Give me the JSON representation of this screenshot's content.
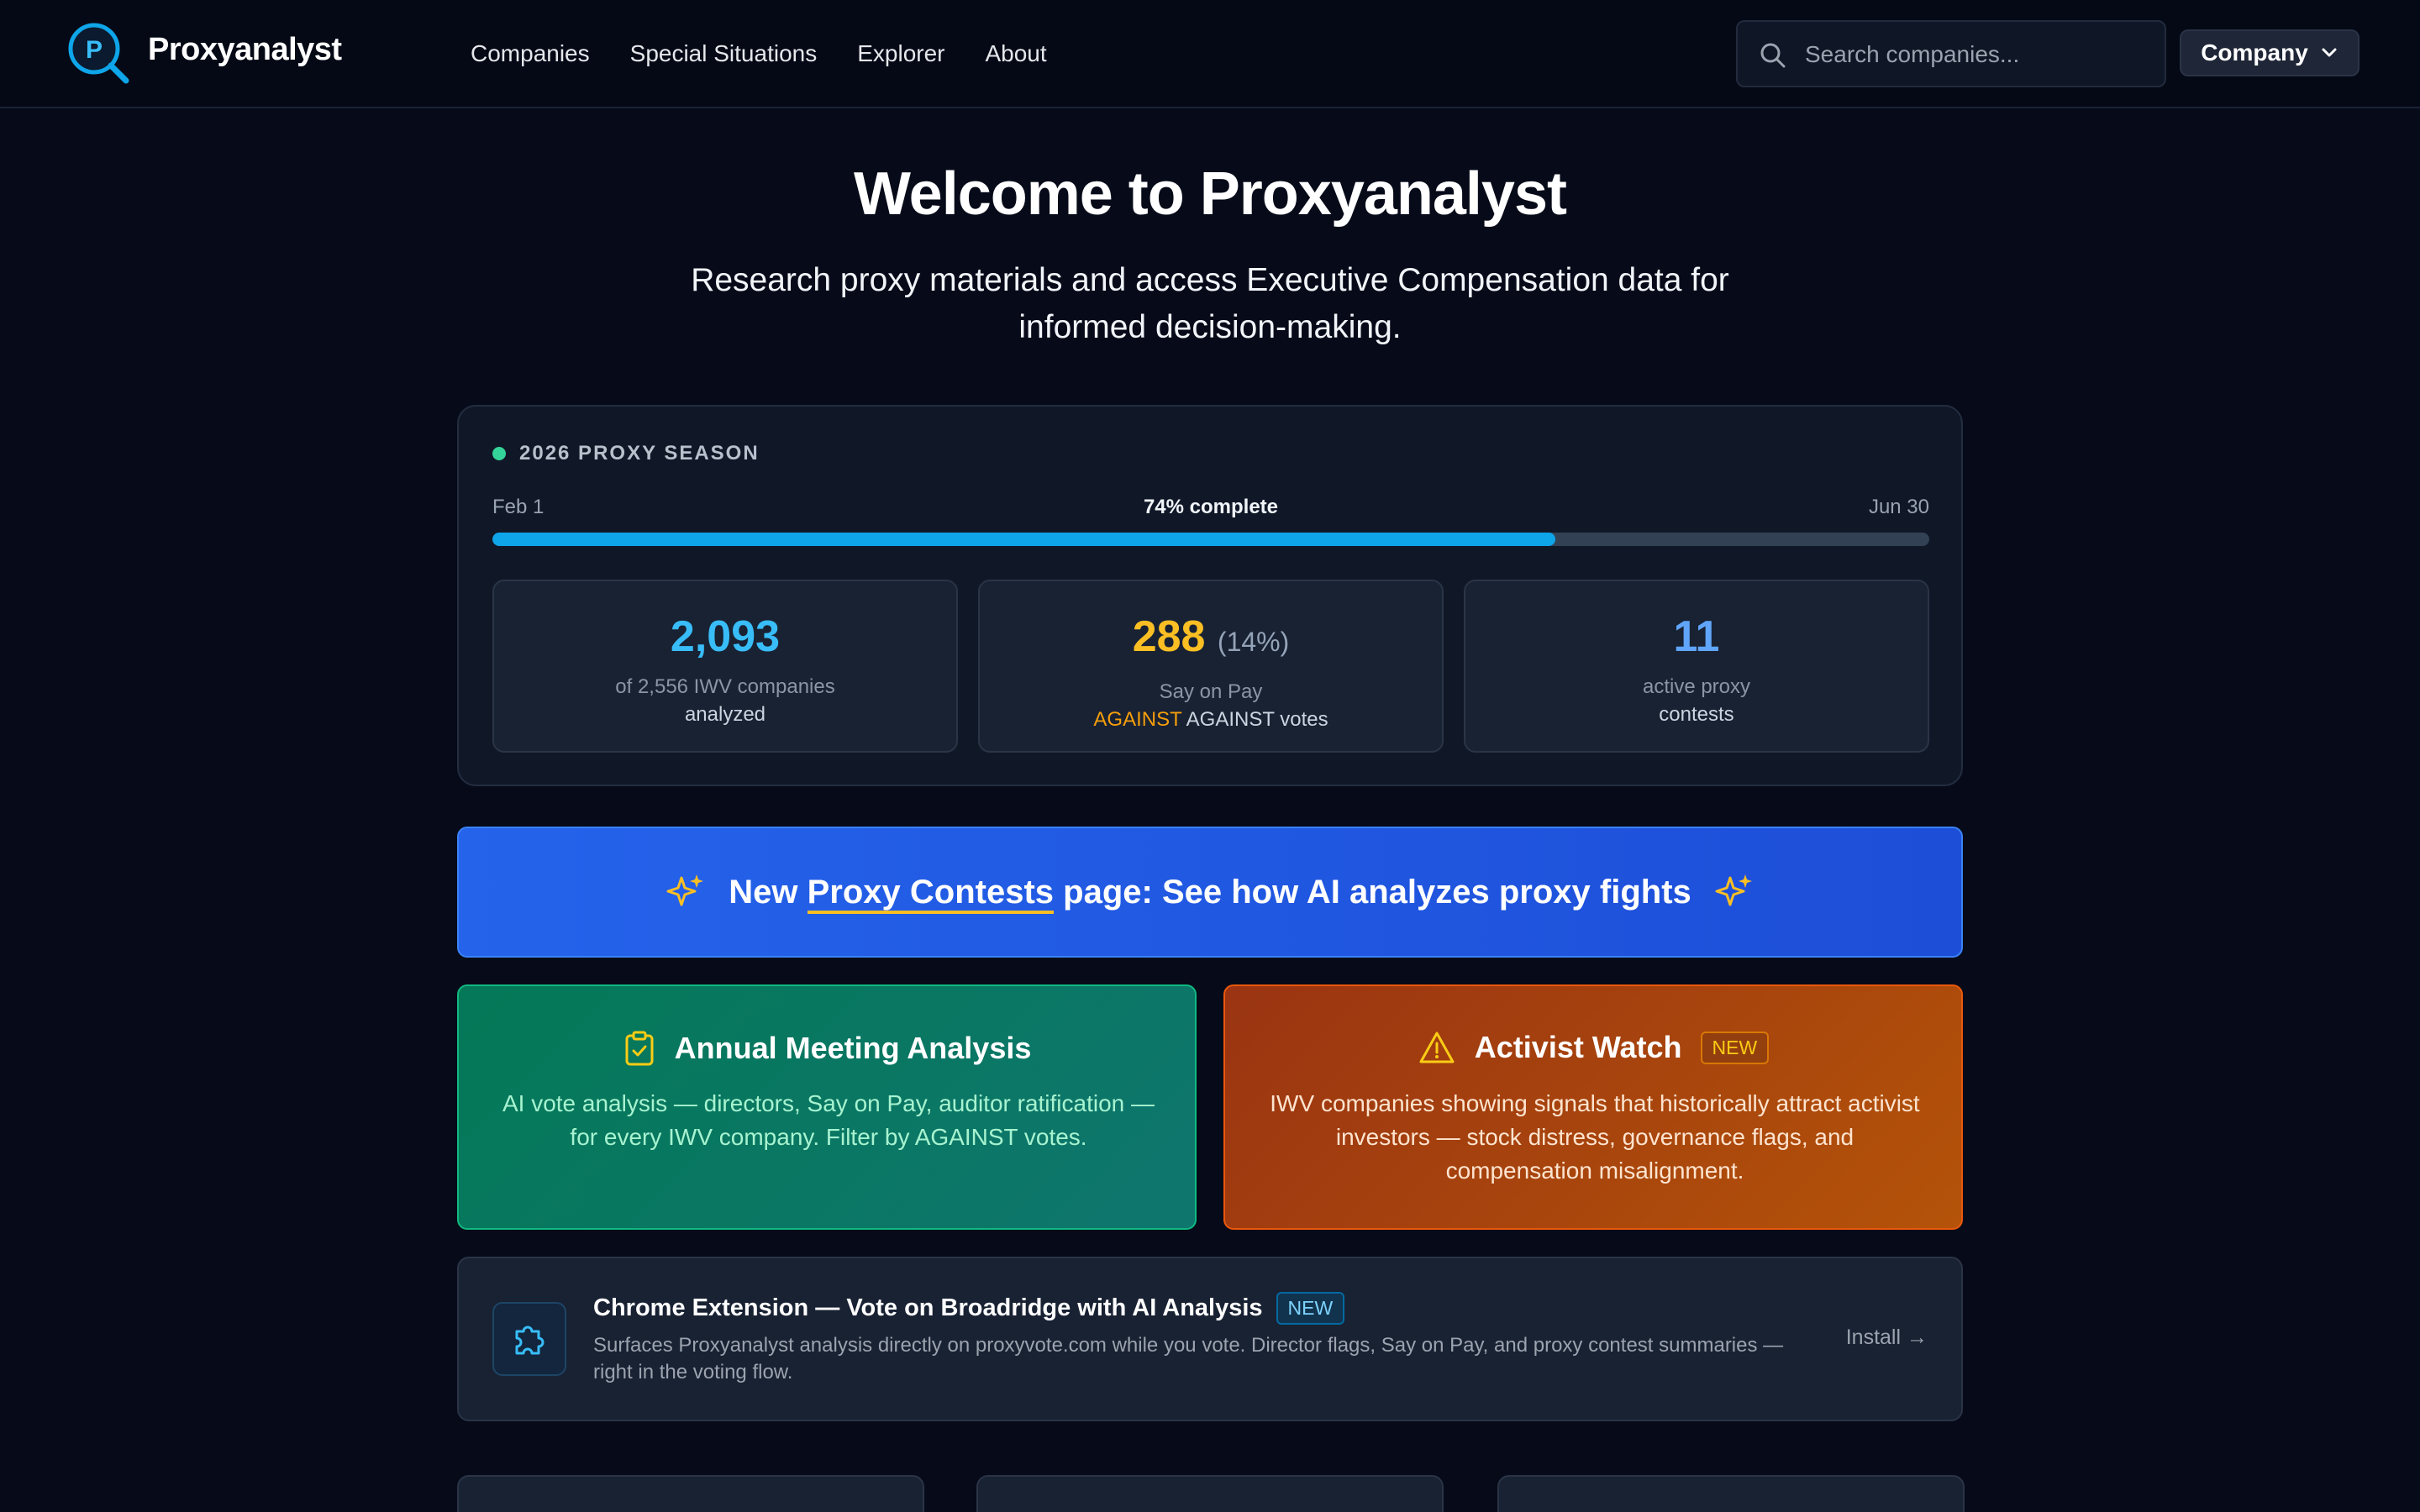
{
  "header": {
    "brand": "Proxyanalyst",
    "logo_letter": "P",
    "nav": [
      "Companies",
      "Special Situations",
      "Explorer",
      "About"
    ],
    "search_placeholder": "Search companies...",
    "company_button": "Company"
  },
  "hero": {
    "title": "Welcome to Proxyanalyst",
    "subtitle": "Research proxy materials and access Executive Compensation data for informed decision-making."
  },
  "season": {
    "label": "2026 PROXY SEASON",
    "start": "Feb 1",
    "end": "Jun 30",
    "progress_text": "74% complete",
    "progress_fraction": 0.74,
    "stats": [
      {
        "value": "2,093",
        "value_color": "#38bdf8",
        "line1": "of 2,556 IWV companies",
        "line2": "analyzed"
      },
      {
        "value": "288",
        "pct": "(14%)",
        "value_color": "#fbbf24",
        "line1": "Say on Pay",
        "line2_accent": "AGAINST",
        "line2": "AGAINST votes"
      },
      {
        "value": "11",
        "value_color": "#60a5fa",
        "line1": "active proxy",
        "line2": "contests"
      }
    ]
  },
  "banner": {
    "prefix": "New",
    "link": "Proxy Contests",
    "suffix": "page: See how AI analyzes proxy fights"
  },
  "cards": {
    "annual": {
      "title": "Annual Meeting Analysis",
      "body": "AI vote analysis — directors, Say on Pay, auditor ratification — for every IWV company. Filter by AGAINST votes."
    },
    "activist": {
      "title": "Activist Watch",
      "badge": "NEW",
      "body": "IWV companies showing signals that historically attract activist investors — stock distress, governance flags, and compensation misalignment."
    }
  },
  "extension": {
    "title": "Chrome Extension — Vote on Broadridge with AI Analysis",
    "badge": "NEW",
    "description": "Surfaces Proxyanalyst analysis directly on proxyvote.com while you vote. Director flags, Say on Pay, and proxy contest summaries — right in the voting flow.",
    "install": "Install →"
  },
  "colors": {
    "background": "#070b19",
    "accent_blue": "#0ea5e9",
    "banner_blue": "#2563eb",
    "green_card": "#047857",
    "orange_card": "#9a3412"
  }
}
